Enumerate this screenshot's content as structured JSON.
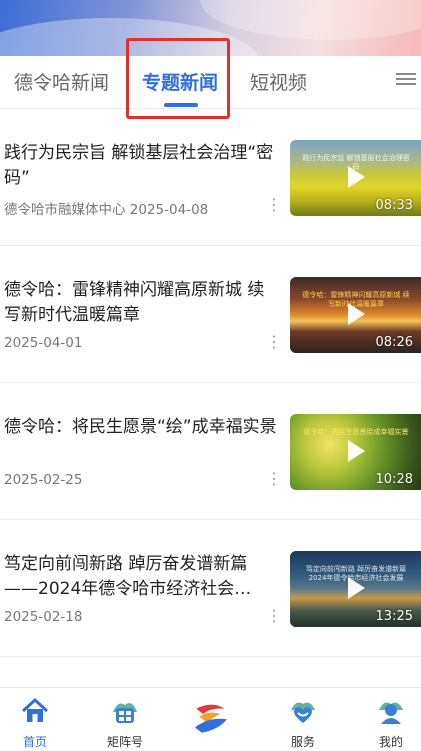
{
  "tabs": [
    {
      "label": "德令哈新闻"
    },
    {
      "label": "专题新闻"
    },
    {
      "label": "短视频"
    }
  ],
  "articles": [
    {
      "title": "践行为民宗旨  解锁基层社会治理“密码”",
      "meta": "德令哈市融媒体中心   2025-04-08",
      "duration": "08:33",
      "caption": "践行为民宗旨 解锁基层社会治理密码"
    },
    {
      "title": "德令哈：雷锋精神闪耀高原新城 续写新时代温暖篇章",
      "meta": "2025-04-01",
      "duration": "08:26",
      "caption": "德令哈：雷锋精神闪耀高原新城 续写新时代温暖篇章"
    },
    {
      "title": "德令哈：将民生愿景“绘”成幸福实景",
      "meta": "2025-02-25",
      "duration": "10:28",
      "caption": "德令哈：将民生愿景绘成幸福实景"
    },
    {
      "title": "笃定向前闯新路  踔厉奋发谱新篇——2024年德令哈市经济社会…",
      "meta": "2025-02-18",
      "duration": "13:25",
      "caption": "笃定向前闯新路 踔厉奋发谱新篇 2024年德令哈市经济社会发展"
    }
  ],
  "more_glyph": "⋮",
  "bottom_nav": [
    {
      "label": "首页",
      "icon": "home-icon"
    },
    {
      "label": "矩阵号",
      "icon": "matrix-icon"
    },
    {
      "label": "",
      "icon": "app-logo-icon"
    },
    {
      "label": "服务",
      "icon": "service-icon"
    },
    {
      "label": "我的",
      "icon": "profile-icon"
    }
  ],
  "colors": {
    "accent": "#2f6fe0",
    "highlight_box": "#e03030"
  }
}
